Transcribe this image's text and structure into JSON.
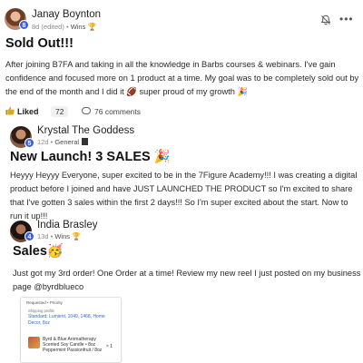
{
  "posts": [
    {
      "author": "Janay Boynton",
      "level": "8",
      "time": "8d (edited)",
      "separator": "•",
      "category": "Wins",
      "category_icon": "🏆",
      "title": "Sold Out!!!",
      "body": "After joining B7FA and taking in all the knowledge in Barbs courses & webinars. I've gain confidence and focused more on 1 product at a time. My goal was to be completely sold out by the end of the month and I did it 🏈 super proud of my growth 🎉",
      "liked_label": "Liked",
      "likes": "72",
      "comments": "76 comments"
    },
    {
      "author": "Krystal The Goddess",
      "level": "5",
      "time": "12d",
      "separator": "•",
      "category": "General",
      "title": "New Launch! 3 SALES 🎉",
      "body": "Heyyy Heyyy Everyone, super excited to be in the 7Figure Academy!!! I was creating a digital product before I joined and have JUST LAUNCHED THE PRODUCT so I'm excited to share that I've gotten 3 sales within the first 2 days!!! So I'm super excited about the start. Now to run it up!!!"
    },
    {
      "author": "India Brasley",
      "level": "4",
      "time": "13d",
      "separator": "•",
      "category": "Wins",
      "category_icon": "🏆",
      "title": "Sales🥳",
      "body": "Just got my 3rd order! One Order at a time! Review my new reel I just posted on my business page @byrdblueco",
      "order_card": {
        "header": "Requested • Priority",
        "shipping_label": "Shipping profile",
        "shipping_text": "Standard: Lumient, 1049, 1468, Home Decor, 8oz",
        "product": "Byrd & Blue Aromatherapy Scented Soy Candle • 8oz Peppermint Passionfruit / 8oz",
        "qty": "× 1"
      }
    }
  ],
  "colors": {
    "level_badge": "#3b5fd8",
    "link": "#2b6cd9"
  },
  "icons": [
    "bell-icon",
    "more-icon",
    "thumbs-up-icon",
    "comment-icon",
    "pin-icon",
    "trophy-icon"
  ]
}
